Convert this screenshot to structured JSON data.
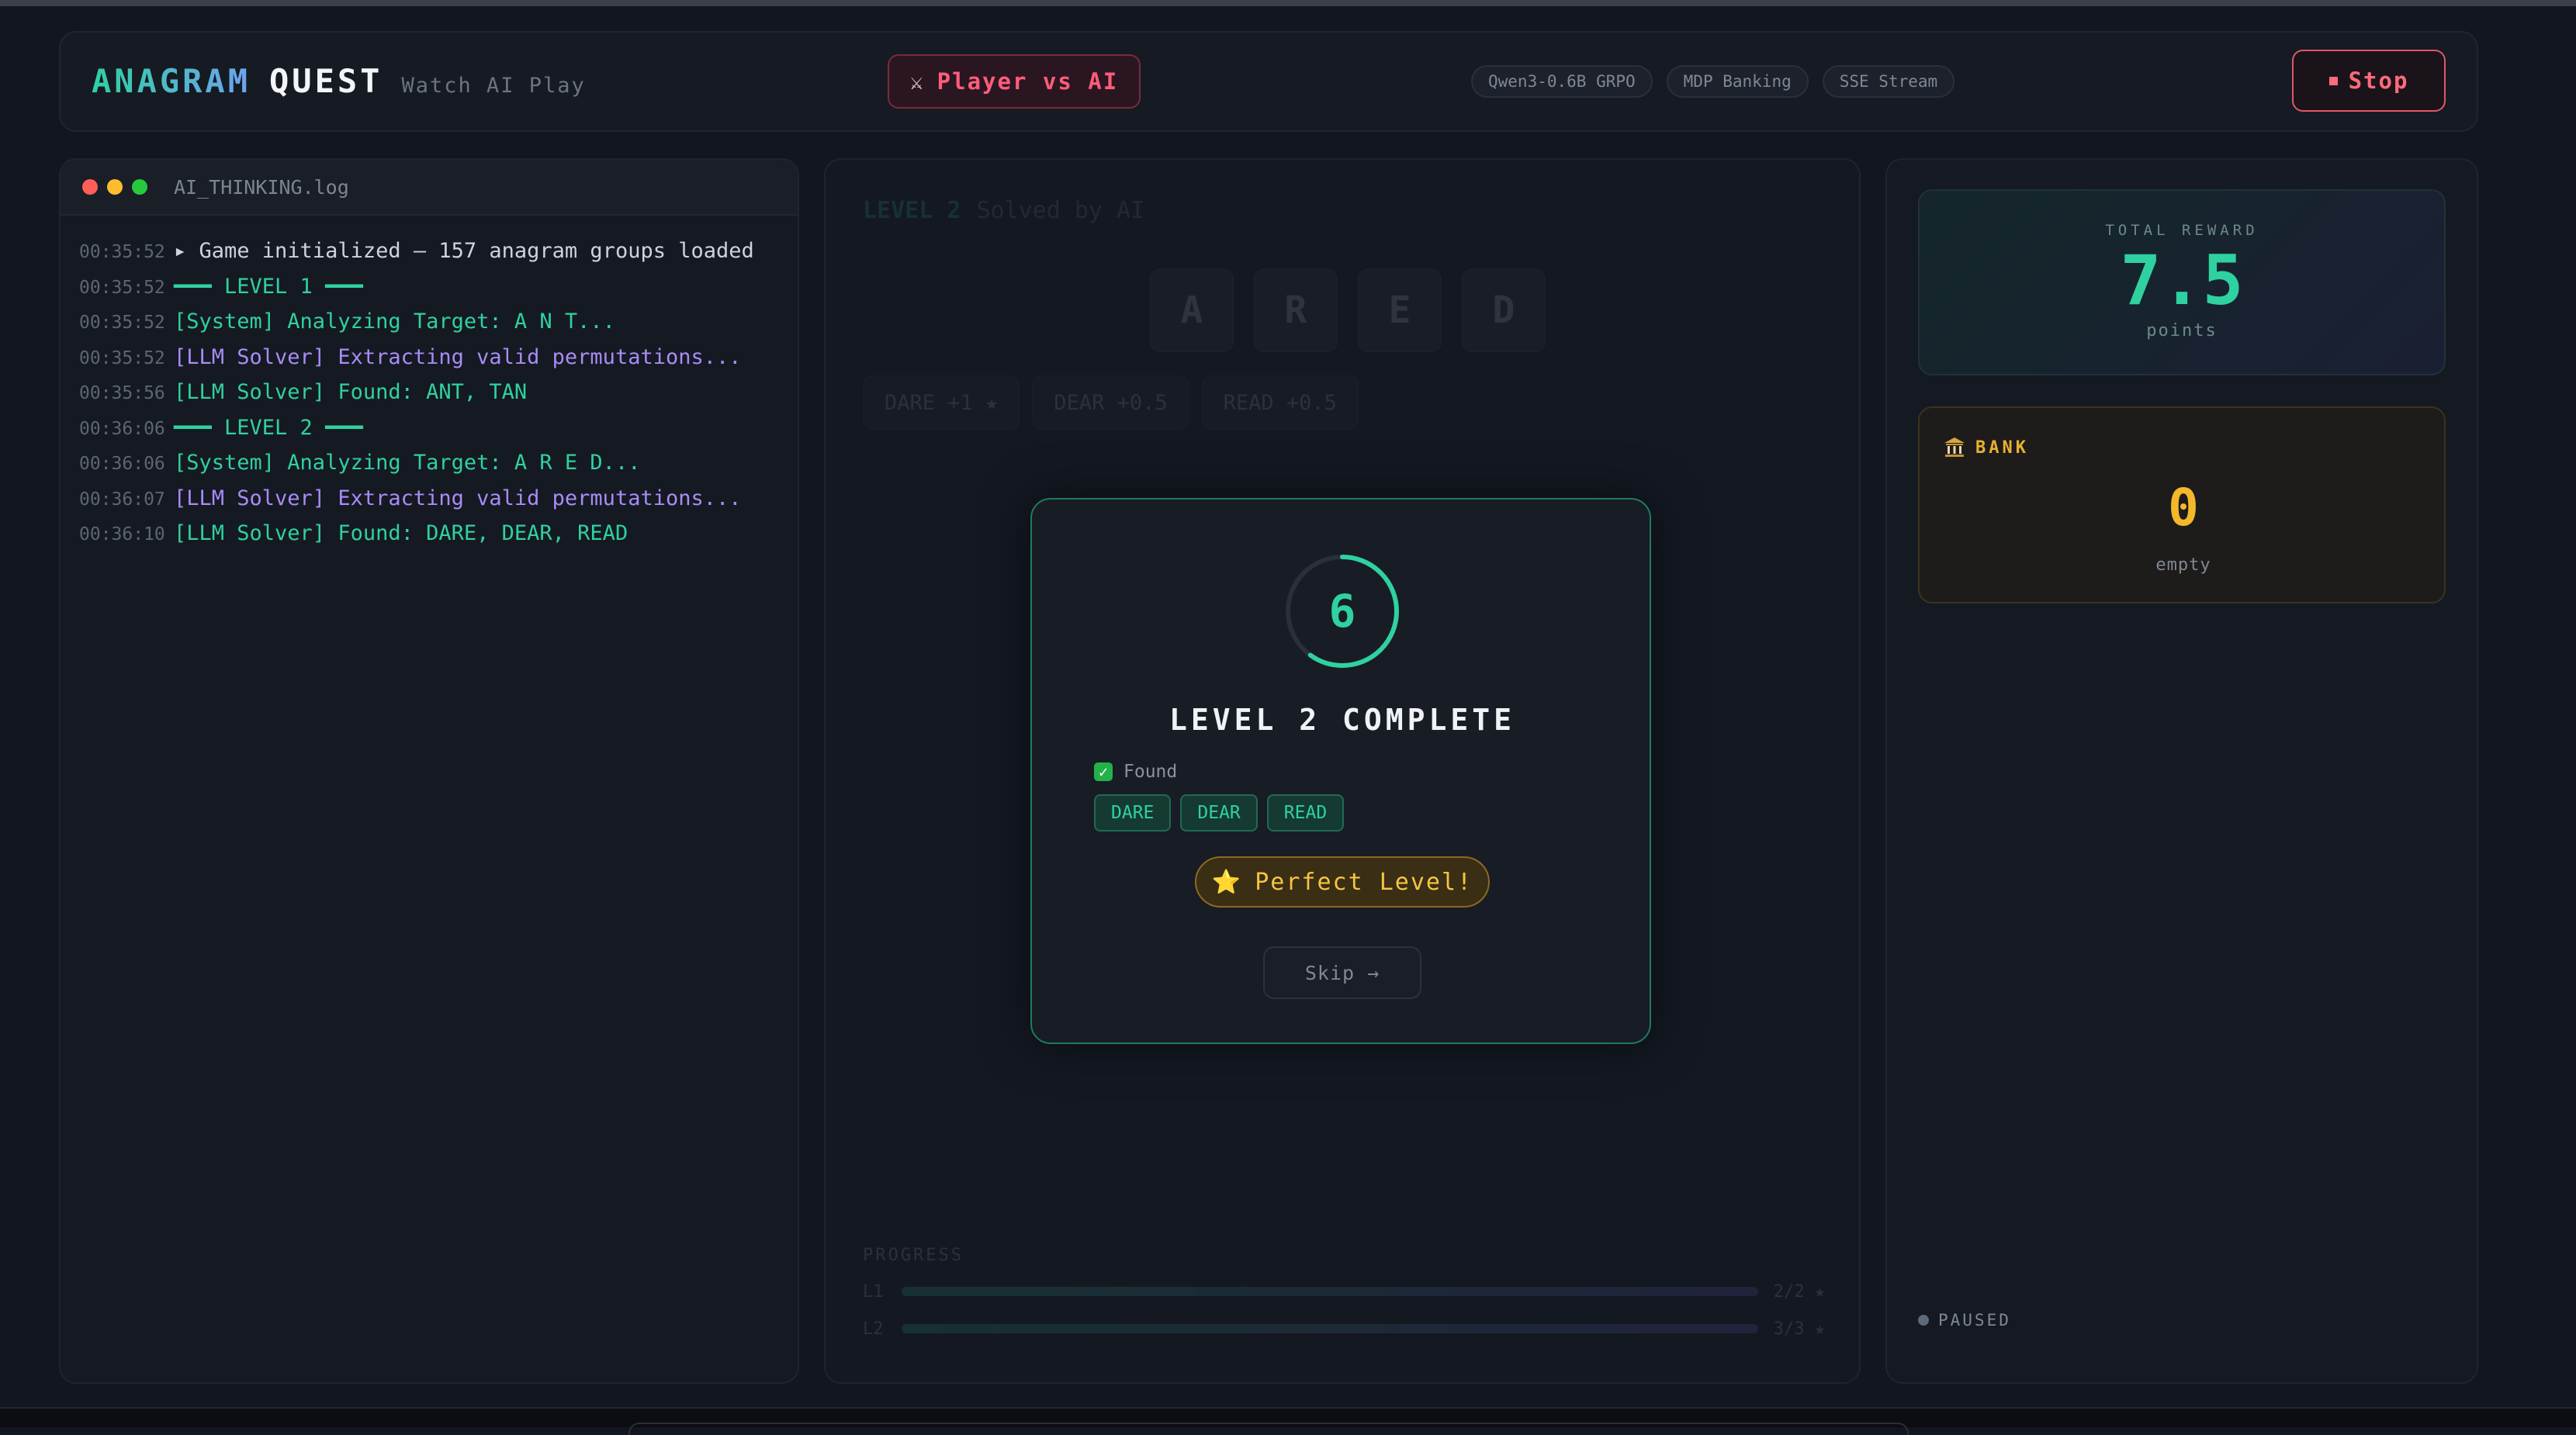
{
  "header": {
    "brand_primary": "ANAGRAM",
    "brand_secondary": "QUEST",
    "brand_tagline": "Watch AI Play",
    "mode_label": "Player vs AI",
    "mode_icon": "crossed-swords-icon",
    "badges": [
      "Qwen3-0.6B GRPO",
      "MDP Banking",
      "SSE Stream"
    ],
    "stop_label": "Stop"
  },
  "terminal": {
    "title": "AI_THINKING.log",
    "lines": [
      {
        "time": "00:35:52",
        "text": "▸ Game initialized — 157 anagram groups loaded",
        "kind": "white"
      },
      {
        "time": "00:35:52",
        "text": "━━━ LEVEL 1 ━━━",
        "kind": "green"
      },
      {
        "time": "00:35:52",
        "text": "[System] Analyzing Target: A N T...",
        "kind": "green"
      },
      {
        "time": "00:35:52",
        "text": "[LLM Solver] Extracting valid permutations...",
        "kind": "purple"
      },
      {
        "time": "00:35:56",
        "text": "[LLM Solver] Found: ANT, TAN",
        "kind": "green"
      },
      {
        "time": "00:36:06",
        "text": "━━━ LEVEL 2 ━━━",
        "kind": "green"
      },
      {
        "time": "00:36:06",
        "text": "[System] Analyzing Target: A R E D...",
        "kind": "green"
      },
      {
        "time": "00:36:07",
        "text": "[LLM Solver] Extracting valid permutations...",
        "kind": "purple"
      },
      {
        "time": "00:36:10",
        "text": "[LLM Solver] Found: DARE, DEAR, READ",
        "kind": "green"
      }
    ]
  },
  "board": {
    "level_label": "LEVEL 2",
    "level_sub": "Solved by AI",
    "tiles": [
      "A",
      "R",
      "E",
      "D"
    ],
    "words": [
      "DARE +1 ★",
      "DEAR +0.5",
      "READ +0.5"
    ],
    "progress_title": "PROGRESS",
    "progress_rows": [
      {
        "label": "L1",
        "value": "2/2 ★"
      },
      {
        "label": "L2",
        "value": "3/3 ★"
      }
    ]
  },
  "modal": {
    "countdown": "6",
    "countdown_fraction": 0.6,
    "title": "LEVEL 2 COMPLETE",
    "found_label": "Found",
    "found_words": [
      "DARE",
      "DEAR",
      "READ"
    ],
    "perfect_label": "Perfect Level!",
    "skip_label": "Skip →"
  },
  "reward": {
    "label": "TOTAL REWARD",
    "value": "7.5",
    "unit": "points"
  },
  "bank": {
    "label": "BANK",
    "value": "0",
    "sub": "empty"
  },
  "status": {
    "label": "PAUSED"
  },
  "colors": {
    "accent": "#2fd1a0",
    "danger": "#ff5c7a",
    "gold": "#f5b82a",
    "purple": "#a88cf5"
  }
}
